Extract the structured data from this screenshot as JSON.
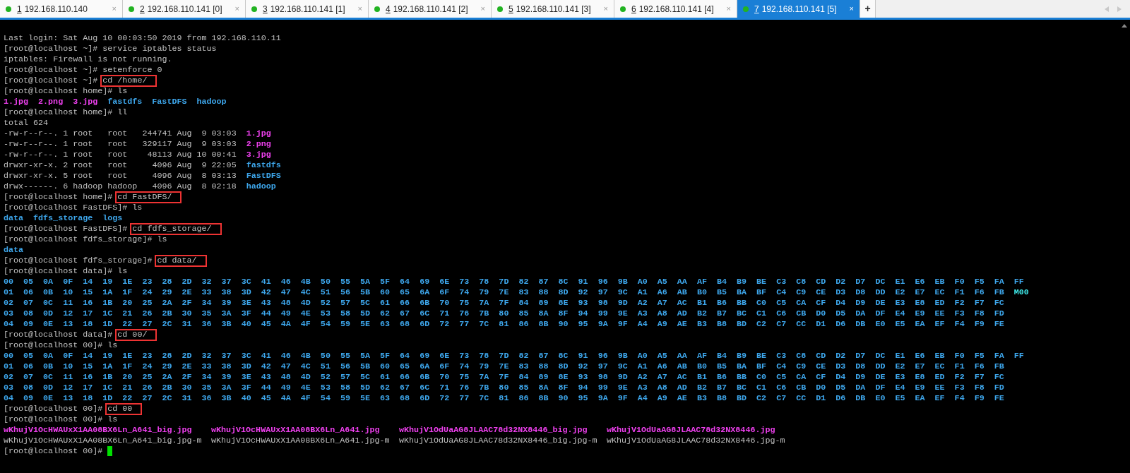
{
  "tabs": [
    {
      "number": "1",
      "title": "192.168.110.140",
      "connected": true,
      "selected": false,
      "close": "×"
    },
    {
      "number": "2",
      "title": "192.168.110.141 [0]",
      "connected": true,
      "selected": false,
      "close": "×"
    },
    {
      "number": "3",
      "title": "192.168.110.141 [1]",
      "connected": true,
      "selected": false,
      "close": "×"
    },
    {
      "number": "4",
      "title": "192.168.110.141 [2]",
      "connected": true,
      "selected": false,
      "close": "×"
    },
    {
      "number": "5",
      "title": "192.168.110.141 [3]",
      "connected": true,
      "selected": false,
      "close": "×"
    },
    {
      "number": "6",
      "title": "192.168.110.141 [4]",
      "connected": true,
      "selected": false,
      "close": "×"
    },
    {
      "number": "7",
      "title": "192.168.110.141 [5]",
      "connected": true,
      "selected": true,
      "close": "×"
    }
  ],
  "new_tab": "+",
  "terminal": {
    "lines": [
      {
        "kind": "output",
        "segments": [
          {
            "text": "Last login: Sat Aug 10 00:03:50 2019 from 192.168.110.11",
            "kind": "plain"
          }
        ]
      },
      {
        "kind": "prompt",
        "prompt": "[root@localhost ~]# ",
        "command": "service iptables status",
        "boxed": false,
        "cursor": false
      },
      {
        "kind": "output",
        "segments": [
          {
            "text": "iptables: Firewall is not running.",
            "kind": "plain"
          }
        ]
      },
      {
        "kind": "prompt",
        "prompt": "[root@localhost ~]# ",
        "command": "setenforce 0",
        "boxed": false,
        "cursor": false
      },
      {
        "kind": "prompt",
        "prompt": "[root@localhost ~]# ",
        "command": "cd /home/",
        "boxed": true,
        "cursor": false
      },
      {
        "kind": "prompt",
        "prompt": "[root@localhost home]# ",
        "command": "ls",
        "boxed": false,
        "cursor": false
      },
      {
        "kind": "output",
        "segments": [
          {
            "text": "1.jpg",
            "kind": "image"
          },
          {
            "text": "2.png",
            "kind": "image"
          },
          {
            "text": "3.jpg",
            "kind": "image"
          },
          {
            "text": "fastdfs",
            "kind": "dir"
          },
          {
            "text": "FastDFS",
            "kind": "dir"
          },
          {
            "text": "hadoop",
            "kind": "dir"
          }
        ]
      },
      {
        "kind": "prompt",
        "prompt": "[root@localhost home]# ",
        "command": "ll",
        "boxed": false,
        "cursor": false
      },
      {
        "kind": "output",
        "segments": [
          {
            "text": "total 624",
            "kind": "plain"
          }
        ]
      },
      {
        "kind": "output",
        "segments": [
          {
            "text": "-rw-r--r--. 1 root   root   244741 Aug  9 03:03",
            "kind": "plain"
          },
          {
            "text": "1.jpg",
            "kind": "image"
          }
        ]
      },
      {
        "kind": "output",
        "segments": [
          {
            "text": "-rw-r--r--. 1 root   root   329117 Aug  9 03:03",
            "kind": "plain"
          },
          {
            "text": "2.png",
            "kind": "image"
          }
        ]
      },
      {
        "kind": "output",
        "segments": [
          {
            "text": "-rw-r--r--. 1 root   root    48113 Aug 10 00:41",
            "kind": "plain"
          },
          {
            "text": "3.jpg",
            "kind": "image"
          }
        ]
      },
      {
        "kind": "output",
        "segments": [
          {
            "text": "drwxr-xr-x. 2 root   root     4096 Aug  9 22:05",
            "kind": "plain"
          },
          {
            "text": "fastdfs",
            "kind": "dir"
          }
        ]
      },
      {
        "kind": "output",
        "segments": [
          {
            "text": "drwxr-xr-x. 5 root   root     4096 Aug  8 03:13",
            "kind": "plain"
          },
          {
            "text": "FastDFS",
            "kind": "dir"
          }
        ]
      },
      {
        "kind": "output",
        "segments": [
          {
            "text": "drwx------. 6 hadoop hadoop   4096 Aug  8 02:18",
            "kind": "plain"
          },
          {
            "text": "hadoop",
            "kind": "dir"
          }
        ]
      },
      {
        "kind": "prompt",
        "prompt": "[root@localhost home]# ",
        "command": "cd FastDFS/",
        "boxed": true,
        "cursor": false
      },
      {
        "kind": "prompt",
        "prompt": "[root@localhost FastDFS]# ",
        "command": "ls",
        "boxed": false,
        "cursor": false
      },
      {
        "kind": "output",
        "segments": [
          {
            "text": "data",
            "kind": "dir"
          },
          {
            "text": "fdfs_storage",
            "kind": "dir"
          },
          {
            "text": "logs",
            "kind": "dir"
          }
        ]
      },
      {
        "kind": "prompt",
        "prompt": "[root@localhost FastDFS]# ",
        "command": "cd fdfs_storage/",
        "boxed": true,
        "cursor": false
      },
      {
        "kind": "prompt",
        "prompt": "[root@localhost fdfs_storage]# ",
        "command": "ls",
        "boxed": false,
        "cursor": false
      },
      {
        "kind": "output",
        "segments": [
          {
            "text": "data",
            "kind": "dir"
          }
        ]
      },
      {
        "kind": "prompt",
        "prompt": "[root@localhost fdfs_storage]# ",
        "command": "cd data/",
        "boxed": true,
        "cursor": false
      },
      {
        "kind": "prompt",
        "prompt": "[root@localhost data]# ",
        "command": "ls",
        "boxed": false,
        "cursor": false
      },
      {
        "kind": "output",
        "segments": [
          {
            "text": "00  05  0A  0F  14  19  1E  23  28  2D  32  37  3C  41  46  4B  50  55  5A  5F  64  69  6E  73  78  7D  82  87  8C  91  96  9B  A0  A5  AA  AF  B4  B9  BE  C3  C8  CD  D2  D7  DC  E1  E6  EB  F0  F5  FA  FF",
            "kind": "dir"
          }
        ]
      },
      {
        "kind": "output",
        "segments": [
          {
            "text": "01  06  0B  10  15  1A  1F  24  29  2E  33  38  3D  42  47  4C  51  56  5B  60  65  6A  6F  74  79  7E  83  88  8D  92  97  9C  A1  A6  AB  B0  B5  BA  BF  C4  C9  CE  D3  D8  DD  E2  E7  EC  F1  F6  FB",
            "kind": "dir"
          },
          {
            "text": "M00",
            "kind": "link"
          }
        ]
      },
      {
        "kind": "output",
        "segments": [
          {
            "text": "02  07  0C  11  16  1B  20  25  2A  2F  34  39  3E  43  48  4D  52  57  5C  61  66  6B  70  75  7A  7F  84  89  8E  93  98  9D  A2  A7  AC  B1  B6  BB  C0  C5  CA  CF  D4  D9  DE  E3  E8  ED  F2  F7  FC",
            "kind": "dir"
          }
        ]
      },
      {
        "kind": "output",
        "segments": [
          {
            "text": "03  08  0D  12  17  1C  21  26  2B  30  35  3A  3F  44  49  4E  53  58  5D  62  67  6C  71  76  7B  80  85  8A  8F  94  99  9E  A3  A8  AD  B2  B7  BC  C1  C6  CB  D0  D5  DA  DF  E4  E9  EE  F3  F8  FD",
            "kind": "dir"
          }
        ]
      },
      {
        "kind": "output",
        "segments": [
          {
            "text": "04  09  0E  13  18  1D  22  27  2C  31  36  3B  40  45  4A  4F  54  59  5E  63  68  6D  72  77  7C  81  86  8B  90  95  9A  9F  A4  A9  AE  B3  B8  BD  C2  C7  CC  D1  D6  DB  E0  E5  EA  EF  F4  F9  FE",
            "kind": "dir"
          }
        ]
      },
      {
        "kind": "prompt",
        "prompt": "[root@localhost data]# ",
        "command": "cd 00/",
        "boxed": true,
        "cursor": false
      },
      {
        "kind": "prompt",
        "prompt": "[root@localhost 00]# ",
        "command": "ls",
        "boxed": false,
        "cursor": false
      },
      {
        "kind": "output",
        "segments": [
          {
            "text": "00  05  0A  0F  14  19  1E  23  28  2D  32  37  3C  41  46  4B  50  55  5A  5F  64  69  6E  73  78  7D  82  87  8C  91  96  9B  A0  A5  AA  AF  B4  B9  BE  C3  C8  CD  D2  D7  DC  E1  E6  EB  F0  F5  FA  FF",
            "kind": "dir"
          }
        ]
      },
      {
        "kind": "output",
        "segments": [
          {
            "text": "01  06  0B  10  15  1A  1F  24  29  2E  33  38  3D  42  47  4C  51  56  5B  60  65  6A  6F  74  79  7E  83  88  8D  92  97  9C  A1  A6  AB  B0  B5  BA  BF  C4  C9  CE  D3  D8  DD  E2  E7  EC  F1  F6  FB",
            "kind": "dir"
          }
        ]
      },
      {
        "kind": "output",
        "segments": [
          {
            "text": "02  07  0C  11  16  1B  20  25  2A  2F  34  39  3E  43  48  4D  52  57  5C  61  66  6B  70  75  7A  7F  84  89  8E  93  98  9D  A2  A7  AC  B1  B6  BB  C0  C5  CA  CF  D4  D9  DE  E3  E8  ED  F2  F7  FC",
            "kind": "dir"
          }
        ]
      },
      {
        "kind": "output",
        "segments": [
          {
            "text": "03  08  0D  12  17  1C  21  26  2B  30  35  3A  3F  44  49  4E  53  58  5D  62  67  6C  71  76  7B  80  85  8A  8F  94  99  9E  A3  A8  AD  B2  B7  BC  C1  C6  CB  D0  D5  DA  DF  E4  E9  EE  F3  F8  FD",
            "kind": "dir"
          }
        ]
      },
      {
        "kind": "output",
        "segments": [
          {
            "text": "04  09  0E  13  18  1D  22  27  2C  31  36  3B  40  45  4A  4F  54  59  5E  63  68  6D  72  77  7C  81  86  8B  90  95  9A  9F  A4  A9  AE  B3  B8  BD  C2  C7  CC  D1  D6  DB  E0  E5  EA  EF  F4  F9  FE",
            "kind": "dir"
          }
        ]
      },
      {
        "kind": "prompt",
        "prompt": "[root@localhost 00]# ",
        "command": "cd 00",
        "boxed": true,
        "cursor": false
      },
      {
        "kind": "prompt",
        "prompt": "[root@localhost 00]# ",
        "command": "ls",
        "boxed": false,
        "cursor": false
      },
      {
        "kind": "grid",
        "segments": [
          {
            "text": "wKhujV1OcHWAUxX1AA08BX6Ln_A641_big.jpg",
            "kind": "image"
          },
          {
            "text": "wKhujV1OcHWAUxX1AA08BX6Ln_A641.jpg",
            "kind": "image"
          },
          {
            "text": "wKhujV1OdUaAG8JLAAC78d32NX8446_big.jpg",
            "kind": "image"
          },
          {
            "text": "wKhujV1OdUaAG8JLAAC78d32NX8446.jpg",
            "kind": "image"
          }
        ]
      },
      {
        "kind": "grid",
        "segments": [
          {
            "text": "wKhujV1OcHWAUxX1AA08BX6Ln_A641_big.jpg-m",
            "kind": "plain"
          },
          {
            "text": "wKhujV1OcHWAUxX1AA08BX6Ln_A641.jpg-m",
            "kind": "plain"
          },
          {
            "text": "wKhujV1OdUaAG8JLAAC78d32NX8446_big.jpg-m",
            "kind": "plain"
          },
          {
            "text": "wKhujV1OdUaAG8JLAAC78d32NX8446.jpg-m",
            "kind": "plain"
          }
        ]
      },
      {
        "kind": "prompt",
        "prompt": "[root@localhost 00]# ",
        "cursor": true
      }
    ]
  }
}
